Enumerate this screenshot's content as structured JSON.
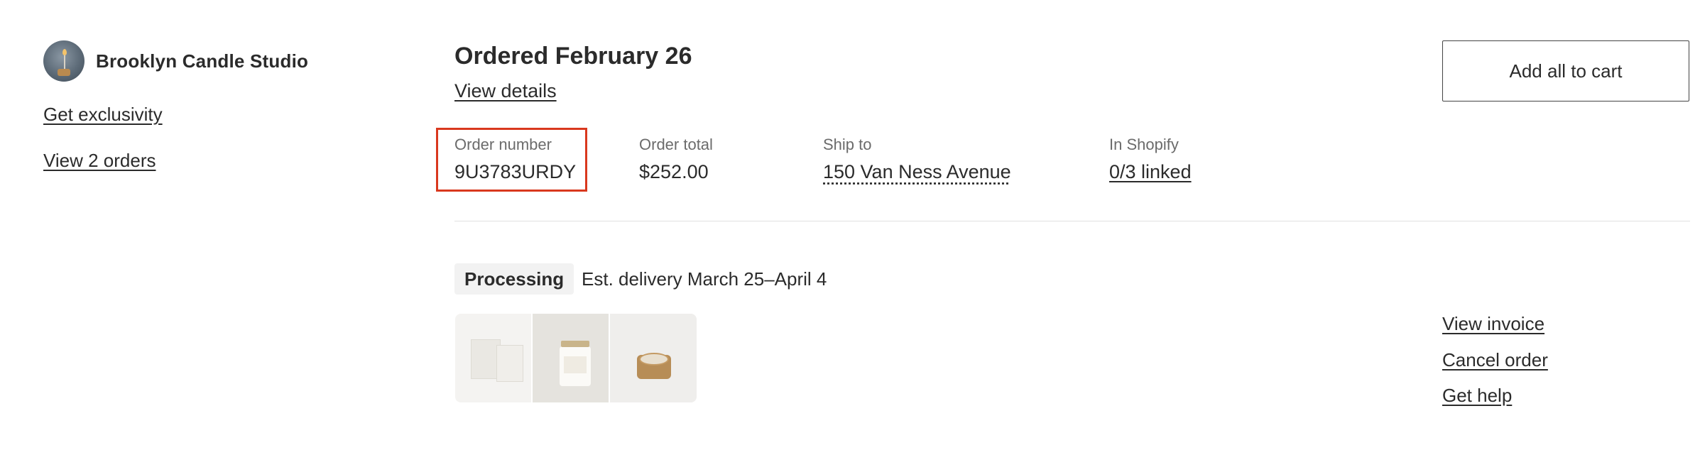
{
  "store": {
    "name": "Brooklyn Candle Studio",
    "links": [
      "Get exclusivity",
      "View 2 orders"
    ]
  },
  "order": {
    "title": "Ordered February 26",
    "view_details": "View details",
    "add_all_to_cart": "Add all to cart",
    "meta": {
      "order_number": {
        "label": "Order number",
        "value": "9U3783URDY"
      },
      "order_total": {
        "label": "Order total",
        "value": "$252.00"
      },
      "ship_to": {
        "label": "Ship to",
        "value": "150 Van Ness Avenue"
      },
      "in_shopify": {
        "label": "In Shopify",
        "value": "0/3 linked"
      }
    },
    "status": "Processing",
    "est_delivery": "Est. delivery March 25–April 4",
    "actions": [
      "View invoice",
      "Cancel order",
      "Get help"
    ]
  },
  "colors": {
    "highlight": "#d9381e",
    "text": "#2b2b2b",
    "muted": "#6b6b6b",
    "badge_bg": "#f2f2f2"
  },
  "icons": [
    "candle-thumbnail-1",
    "candle-thumbnail-2",
    "candle-thumbnail-3"
  ]
}
